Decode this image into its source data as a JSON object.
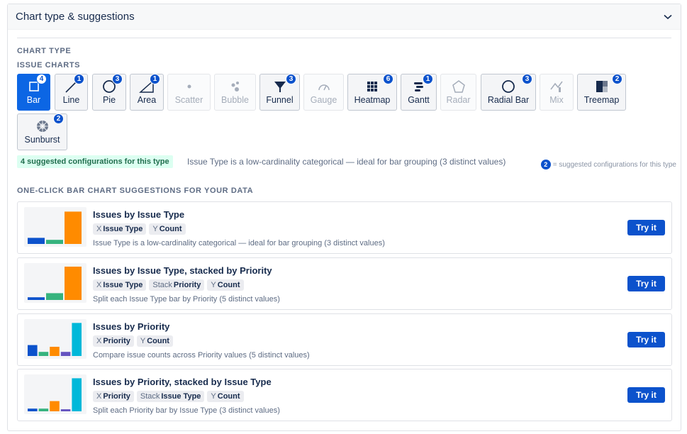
{
  "panel": {
    "title": "Chart type & suggestions"
  },
  "section": {
    "chart_type_label": "CHART TYPE",
    "issue_charts_label": "ISSUE CHARTS"
  },
  "chart_types": [
    {
      "label": "Bar",
      "badge": "4",
      "state": "active",
      "icon": "bar-icon"
    },
    {
      "label": "Line",
      "badge": "1",
      "state": "normal",
      "icon": "line-icon"
    },
    {
      "label": "Pie",
      "badge": "3",
      "state": "normal",
      "icon": "pie-icon"
    },
    {
      "label": "Area",
      "badge": "1",
      "state": "normal",
      "icon": "area-icon"
    },
    {
      "label": "Scatter",
      "badge": "",
      "state": "disabled",
      "icon": "scatter-icon"
    },
    {
      "label": "Bubble",
      "badge": "",
      "state": "disabled",
      "icon": "bubble-icon"
    },
    {
      "label": "Funnel",
      "badge": "3",
      "state": "normal",
      "icon": "funnel-icon"
    },
    {
      "label": "Gauge",
      "badge": "",
      "state": "disabled",
      "icon": "gauge-icon"
    },
    {
      "label": "Heatmap",
      "badge": "6",
      "state": "normal",
      "icon": "heatmap-icon"
    },
    {
      "label": "Gantt",
      "badge": "1",
      "state": "normal",
      "icon": "gantt-icon"
    },
    {
      "label": "Radar",
      "badge": "",
      "state": "disabled",
      "icon": "radar-icon"
    },
    {
      "label": "Radial Bar",
      "badge": "3",
      "state": "normal",
      "icon": "radial-bar-icon"
    },
    {
      "label": "Mix",
      "badge": "",
      "state": "disabled",
      "icon": "mix-icon"
    },
    {
      "label": "Treemap",
      "badge": "2",
      "state": "normal",
      "icon": "treemap-icon"
    },
    {
      "label": "Sunburst",
      "badge": "2",
      "state": "normal",
      "icon": "sunburst-icon"
    }
  ],
  "info": {
    "suggested_pill": "4 suggested configurations for this type",
    "description": "Issue Type is a low-cardinality categorical — ideal for bar grouping (3 distinct values)",
    "legend_badge": "2",
    "legend_text": "= suggested configurations for this type"
  },
  "suggestions_label": "ONE-CLICK BAR CHART SUGGESTIONS FOR YOUR DATA",
  "suggestions": [
    {
      "title": "Issues by Issue Type",
      "chips": [
        {
          "k": "X",
          "v": "Issue Type"
        },
        {
          "k": "Y",
          "v": "Count"
        }
      ],
      "desc": "Issue Type is a low-cardinality categorical — ideal for bar grouping (3 distinct values)",
      "button": "Try it",
      "thumb_values": [
        0.18,
        0.12,
        0.95
      ],
      "thumb_colors": [
        "#0c52cc",
        "#36b37e",
        "#ff8b00"
      ]
    },
    {
      "title": "Issues by Issue Type, stacked by Priority",
      "chips": [
        {
          "k": "X",
          "v": "Issue Type"
        },
        {
          "k": "Stack",
          "v": "Priority"
        },
        {
          "k": "Y",
          "v": "Count"
        }
      ],
      "desc": "Split each Issue Type bar by Priority (5 distinct values)",
      "button": "Try it",
      "thumb_values": [
        0.08,
        0.2,
        0.98
      ],
      "thumb_colors": [
        "#0c52cc",
        "#36b37e",
        "#ff8b00"
      ]
    },
    {
      "title": "Issues by Priority",
      "chips": [
        {
          "k": "X",
          "v": "Priority"
        },
        {
          "k": "Y",
          "v": "Count"
        }
      ],
      "desc": "Compare issue counts across Priority values (5 distinct values)",
      "button": "Try it",
      "thumb_values": [
        0.32,
        0.12,
        0.27,
        0.12,
        0.97
      ],
      "thumb_colors": [
        "#0c52cc",
        "#36b37e",
        "#ff8b00",
        "#6554c0",
        "#00b8d9"
      ]
    },
    {
      "title": "Issues by Priority, stacked by Issue Type",
      "chips": [
        {
          "k": "X",
          "v": "Priority"
        },
        {
          "k": "Stack",
          "v": "Issue Type"
        },
        {
          "k": "Y",
          "v": "Count"
        }
      ],
      "desc": "Split each Priority bar by Issue Type (3 distinct values)",
      "button": "Try it",
      "thumb_values": [
        0.08,
        0.08,
        0.3,
        0.06,
        0.97
      ],
      "thumb_colors": [
        "#0c52cc",
        "#36b37e",
        "#ff8b00",
        "#6554c0",
        "#00b8d9"
      ]
    }
  ]
}
